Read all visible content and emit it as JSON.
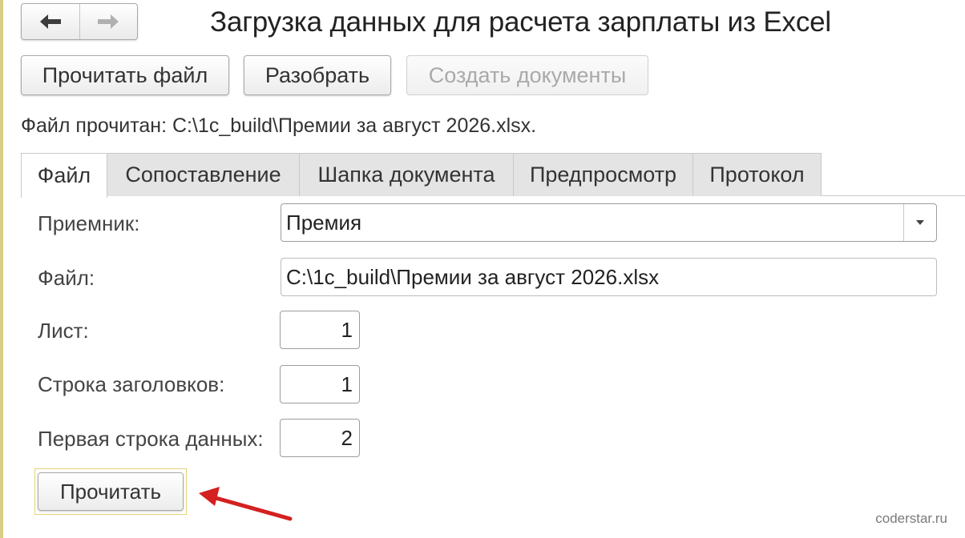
{
  "header": {
    "title": "Загрузка данных для расчета зарплаты из Excel",
    "back_icon": "arrow-left-icon",
    "forward_icon": "arrow-right-icon"
  },
  "toolbar": {
    "read_file_label": "Прочитать файл",
    "parse_label": "Разобрать",
    "create_docs_label": "Создать документы"
  },
  "status_text": "Файл прочитан: C:\\1c_build\\Премии за август 2026.xlsx.",
  "tabs": [
    {
      "label": "Файл",
      "active": true
    },
    {
      "label": "Сопоставление",
      "active": false
    },
    {
      "label": "Шапка документа",
      "active": false
    },
    {
      "label": "Предпросмотр",
      "active": false
    },
    {
      "label": "Протокол",
      "active": false
    }
  ],
  "form": {
    "receiver_label": "Приемник:",
    "receiver_value": "Премия",
    "file_label": "Файл:",
    "file_value": "C:\\1c_build\\Премии за август 2026.xlsx",
    "sheet_label": "Лист:",
    "sheet_value": "1",
    "header_row_label": "Строка заголовков:",
    "header_row_value": "1",
    "first_data_row_label": "Первая строка данных:",
    "first_data_row_value": "2",
    "read_button_label": "Прочитать"
  },
  "watermark": "coderstar.ru",
  "colors": {
    "annotation_arrow": "#d42020",
    "highlight_border": "#e2d27a"
  }
}
